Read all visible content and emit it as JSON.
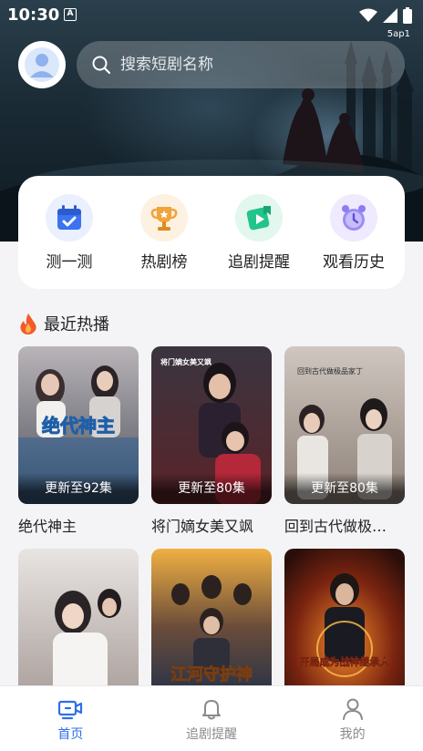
{
  "status_bar": {
    "time": "10:30",
    "indicator": "A",
    "watermark": "5ap1"
  },
  "header": {
    "avatar_icon": "user-avatar-icon",
    "search": {
      "placeholder": "搜索短剧名称",
      "icon": "search-icon"
    }
  },
  "quick_actions": [
    {
      "label": "测一测",
      "icon": "calendar-check-icon",
      "color": "#3b73f0"
    },
    {
      "label": "热剧榜",
      "icon": "trophy-icon",
      "color": "#f2a33a"
    },
    {
      "label": "追剧提醒",
      "icon": "play-bookmark-icon",
      "color": "#23c48c"
    },
    {
      "label": "观看历史",
      "icon": "alarm-clock-icon",
      "color": "#8c7df2"
    }
  ],
  "section": {
    "title": "最近热播",
    "icon": "fire-icon"
  },
  "dramas": [
    {
      "title": "绝代神主",
      "badge": "更新至92集",
      "poster_text": "绝代神主"
    },
    {
      "title": "将门嫡女美又飒",
      "badge": "更新至80集",
      "poster_text": "将门嫡女美又飒"
    },
    {
      "title": "回到古代做极…",
      "badge": "更新至80集",
      "poster_text": "回到古代做极品家丁"
    },
    {
      "title": "",
      "badge": "",
      "poster_text": ""
    },
    {
      "title": "",
      "badge": "",
      "poster_text": "江河守护神"
    },
    {
      "title": "",
      "badge": "",
      "poster_text": "开局成为战神继承人"
    }
  ],
  "bottom_nav": [
    {
      "label": "首页",
      "icon": "tv-home-icon",
      "active": true
    },
    {
      "label": "追剧提醒",
      "icon": "bell-icon",
      "active": false
    },
    {
      "label": "我的",
      "icon": "person-icon",
      "active": false
    }
  ],
  "colors": {
    "accent": "#2f6fe6",
    "card_bg": "#ffffff",
    "page_bg": "#f4f4f6"
  }
}
